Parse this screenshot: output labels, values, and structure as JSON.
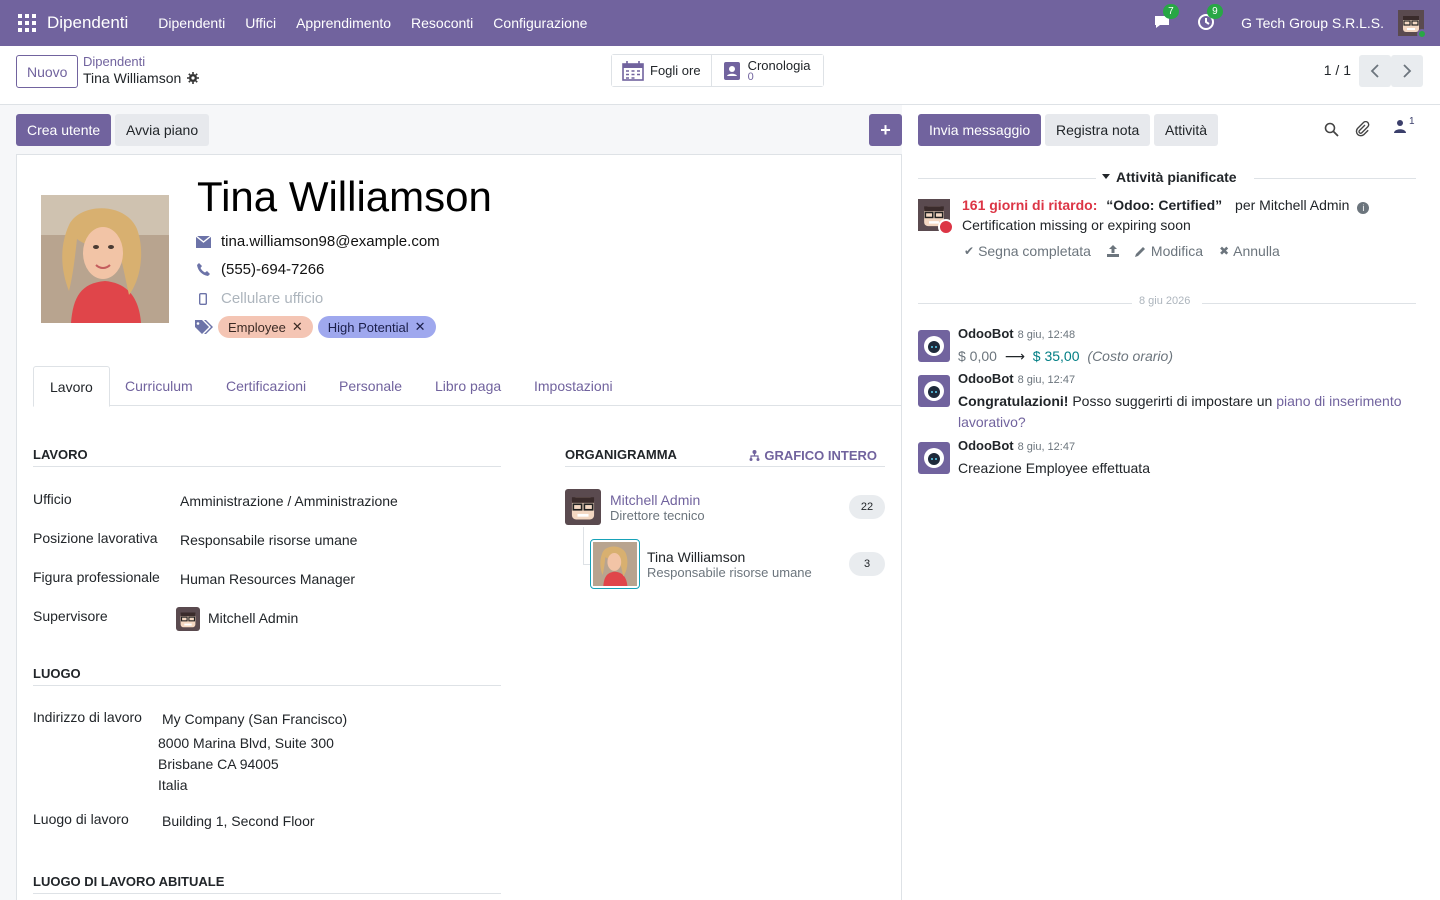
{
  "navbar": {
    "app_name": "Dipendenti",
    "menu": [
      "Dipendenti",
      "Uffici",
      "Apprendimento",
      "Resoconti",
      "Configurazione"
    ],
    "messages_count": "7",
    "activities_count": "9",
    "company": "G Tech Group S.R.L.S."
  },
  "control": {
    "new_label": "Nuovo",
    "breadcrumb_parent": "Dipendenti",
    "breadcrumb_current": "Tina Williamson",
    "timesheets_label": "Fogli ore",
    "history_label": "Cronologia",
    "history_count": "0",
    "pager": "1 / 1"
  },
  "status_bar": {
    "create_user": "Crea utente",
    "start_plan": "Avvia piano",
    "add": "+"
  },
  "employee": {
    "name": "Tina Williamson",
    "email": "tina.williamson98@example.com",
    "phone": "(555)-694-7266",
    "mobile_placeholder": "Cellulare ufficio",
    "tags": [
      "Employee",
      "High Potential"
    ]
  },
  "tabs": [
    "Lavoro",
    "Curriculum",
    "Certificazioni",
    "Personale",
    "Libro paga",
    "Impostazioni"
  ],
  "work": {
    "section_title": "LAVORO",
    "department_label": "Ufficio",
    "department_value": "Amministrazione / Amministrazione",
    "job_position_label": "Posizione lavorativa",
    "job_position_value": "Responsabile risorse umane",
    "job_title_label": "Figura professionale",
    "job_title_value": "Human Resources Manager",
    "manager_label": "Supervisore",
    "manager_value": "Mitchell Admin"
  },
  "location": {
    "section_title": "LUOGO",
    "address_label": "Indirizzo di lavoro",
    "address_company": "My Company (San Francisco)",
    "address_line1": "8000 Marina Blvd, Suite 300",
    "address_line2": "Brisbane CA 94005",
    "address_country": "Italia",
    "place_label": "Luogo di lavoro",
    "place_value": "Building 1, Second Floor",
    "habitual_title": "LUOGO DI LAVORO ABITUALE"
  },
  "org": {
    "title": "ORGANIGRAMMA",
    "full_chart": "GRAFICO INTERO",
    "manager_name": "Mitchell Admin",
    "manager_job": "Direttore tecnico",
    "manager_count": "22",
    "employee_name": "Tina Williamson",
    "employee_job": "Responsabile risorse umane",
    "employee_count": "3"
  },
  "chatter": {
    "send_message": "Invia messaggio",
    "log_note": "Registra nota",
    "activities": "Attività",
    "followers_count": "1",
    "planned_title": "Attività pianificate",
    "activity": {
      "overdue": "161 giorni di ritardo:",
      "title": "“Odoo: Certified”",
      "assigned": "per Mitchell Admin",
      "note": "Certification missing or expiring soon",
      "mark_done": "Segna completata",
      "edit": "Modifica",
      "cancel": "Annulla"
    },
    "date_separator": "8 giu 2026",
    "messages": [
      {
        "author": "OdooBot",
        "time": "8 giu, 12:48",
        "old": "$ 0,00",
        "new": "$ 35,00",
        "field": "(Costo orario)"
      },
      {
        "author": "OdooBot",
        "time": "8 giu, 12:47",
        "bold": "Congratulazioni!",
        "text": "Posso suggerirti di impostare un",
        "link": "piano di inserimento lavorativo?"
      },
      {
        "author": "OdooBot",
        "time": "8 giu, 12:47",
        "text": "Creazione Employee effettuata"
      }
    ]
  },
  "colors": {
    "brand": "#71639e",
    "danger": "#dc3545",
    "success": "#28a745",
    "tag_employee": "#f4c5b4",
    "tag_potential": "#9fa8ee"
  }
}
